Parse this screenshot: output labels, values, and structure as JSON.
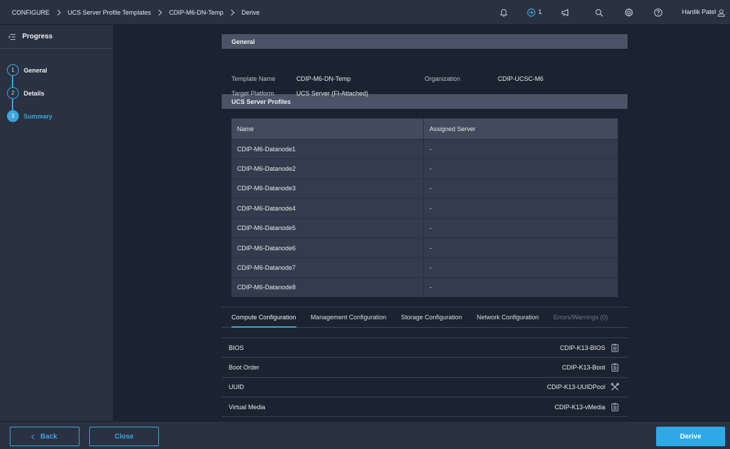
{
  "breadcrumbs": [
    "CONFIGURE",
    "UCS Server Profile Templates",
    "CDIP-M6-DN-Temp",
    "Derive"
  ],
  "topbar": {
    "requests_count": "1",
    "user_name": "Hardik Patel",
    "icons": [
      "bell-icon",
      "requests-icon",
      "announcement-icon",
      "search-icon",
      "gear-icon",
      "help-icon",
      "user-icon"
    ]
  },
  "progress": {
    "title": "Progress",
    "steps": [
      {
        "number": "1",
        "label": "General"
      },
      {
        "number": "2",
        "label": "Details"
      },
      {
        "number": "3",
        "label": "Summary"
      }
    ],
    "active_step": 3
  },
  "general": {
    "heading": "General",
    "template_name_label": "Template Name",
    "template_name_value": "CDIP-M6-DN-Temp",
    "organization_label": "Organization",
    "organization_value": "CDIP-UCSC-M6",
    "target_platform_label": "Target Platform",
    "target_platform_value": "UCS Server (FI-Attached)"
  },
  "profiles": {
    "heading": "UCS Server Profiles",
    "columns": [
      "Name",
      "Assigned Server"
    ],
    "rows": [
      [
        "CDIP-M6-Datanode1",
        "-"
      ],
      [
        "CDIP-M6-Datanode2",
        "-"
      ],
      [
        "CDIP-M6-Datanode3",
        "-"
      ],
      [
        "CDIP-M6-Datanode4",
        "-"
      ],
      [
        "CDIP-M6-Datanode5",
        "-"
      ],
      [
        "CDIP-M6-Datanode6",
        "-"
      ],
      [
        "CDIP-M6-Datanode7",
        "-"
      ],
      [
        "CDIP-M6-Datanode8",
        "-"
      ]
    ]
  },
  "tabs": [
    {
      "label": "Compute Configuration",
      "active": true,
      "disabled": false
    },
    {
      "label": "Management Configuration",
      "active": false,
      "disabled": false
    },
    {
      "label": "Storage Configuration",
      "active": false,
      "disabled": false
    },
    {
      "label": "Network Configuration",
      "active": false,
      "disabled": false
    },
    {
      "label": "Errors/Warnings (0)",
      "active": false,
      "disabled": true
    }
  ],
  "compute": [
    {
      "label": "BIOS",
      "value": "CDIP-K13-BIOS",
      "icon": "clipboard-icon"
    },
    {
      "label": "Boot Order",
      "value": "CDIP-K13-Boot",
      "icon": "clipboard-icon"
    },
    {
      "label": "UUID",
      "value": "CDIP-K13-UUIDPool",
      "icon": "tools-icon"
    },
    {
      "label": "Virtual Media",
      "value": "CDIP-K13-vMedia",
      "icon": "clipboard-icon"
    }
  ],
  "buttons": {
    "back": "Back",
    "close": "Close",
    "derive": "Derive"
  },
  "colors": {
    "accent": "#3aa6dd",
    "primary_button": "#2ea8e6",
    "background": "#1b2330",
    "panel": "#2a3242"
  }
}
